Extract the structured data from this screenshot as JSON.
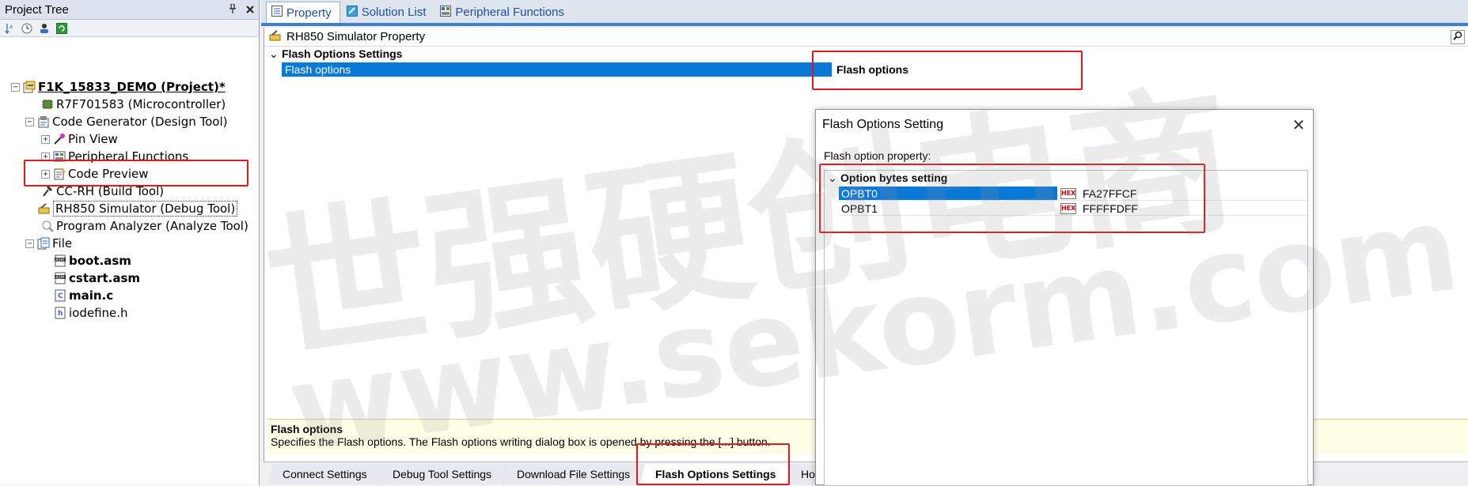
{
  "project_tree": {
    "title": "Project Tree",
    "pin_icon": "pin-icon",
    "close_icon": "close-icon",
    "nodes": [
      {
        "label": "F1K_15833_DEMO (Project)*",
        "bold": true,
        "icon": "project-icon",
        "expander": "−"
      },
      {
        "label": "R7F701583 (Microcontroller)",
        "icon": "chip-icon"
      },
      {
        "label": "Code Generator (Design Tool)",
        "icon": "code-generator-icon",
        "expander": "−"
      },
      {
        "label": "Pin View",
        "icon": "pin-view-icon",
        "expander": "+"
      },
      {
        "label": "Peripheral Functions",
        "icon": "peripheral-icon",
        "expander": "+"
      },
      {
        "label": "Code Preview",
        "icon": "code-preview-icon",
        "expander": "+"
      },
      {
        "label": "CC-RH (Build Tool)",
        "icon": "build-tool-icon"
      },
      {
        "label": "RH850 Simulator (Debug Tool)",
        "icon": "debug-tool-icon"
      },
      {
        "label": "Program Analyzer (Analyze Tool)",
        "icon": "analyzer-icon"
      },
      {
        "label": "File",
        "icon": "folder-icon",
        "expander": "−"
      },
      {
        "label": "boot.asm",
        "bold": true,
        "icon": "asm-file-icon"
      },
      {
        "label": "cstart.asm",
        "bold": true,
        "icon": "asm-file-icon"
      },
      {
        "label": "main.c",
        "bold": true,
        "icon": "c-file-icon"
      },
      {
        "label": "iodefine.h",
        "icon": "h-file-icon"
      }
    ]
  },
  "top_tabs": [
    {
      "label": "Property",
      "icon": "property-icon",
      "active": true
    },
    {
      "label": "Solution List",
      "icon": "solution-list-icon"
    },
    {
      "label": "Peripheral Functions",
      "icon": "peripheral-functions-icon"
    }
  ],
  "property": {
    "header": "RH850 Simulator Property",
    "category": "Flash Options Settings",
    "category_expander": "⌄",
    "row_name": "Flash options",
    "row_value": "Flash options",
    "description_title": "Flash options",
    "description_text": "Specifies the Flash options. The Flash options writing dialog box is opened by pressing the [...] button."
  },
  "bottom_tabs": [
    {
      "label": "Connect Settings"
    },
    {
      "label": "Debug Tool Settings"
    },
    {
      "label": "Download File Settings"
    },
    {
      "label": "Flash Options Settings",
      "active": true
    },
    {
      "label": "Ho"
    }
  ],
  "dialog": {
    "title": "Flash Options Setting",
    "close_glyph": "✕",
    "label": "Flash option property:",
    "category": "Option bytes setting",
    "category_expander": "⌄",
    "hex_badge": "HEX",
    "rows": [
      {
        "name": "OPBT0",
        "value": "FA27FFCF",
        "selected": true
      },
      {
        "name": "OPBT1",
        "value": "FFFFFDFF"
      }
    ]
  },
  "watermark": {
    "main": "世强硬创电商",
    "url": "www.sekorm.com"
  },
  "colors": {
    "selection": "#0a78d7",
    "highlight": "#e01a1a",
    "tab_accent": "#3d7fd6"
  }
}
